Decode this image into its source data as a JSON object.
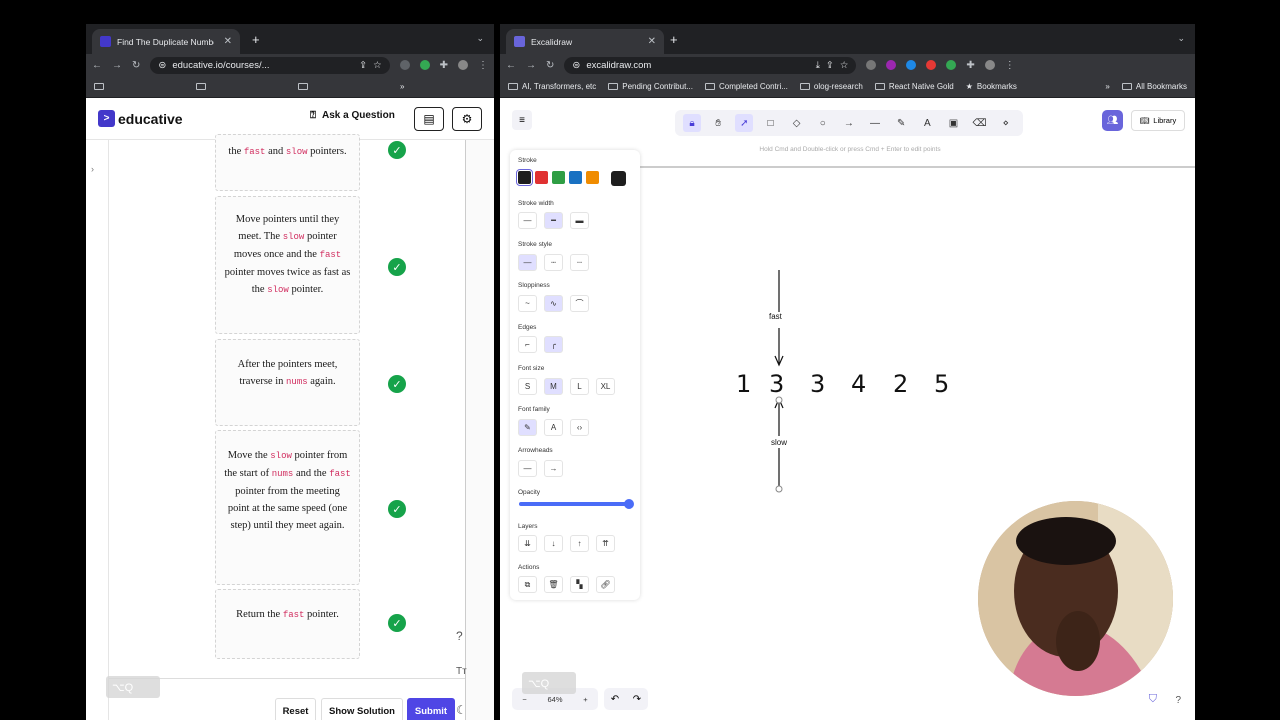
{
  "left_window": {
    "tab_title": "Find The Duplicate Number - C",
    "url": "educative.io/courses/...",
    "logo_text": "educative",
    "ask_question": "Ask a Question",
    "steps": [
      {
        "parts": [
          {
            "t": "the "
          },
          {
            "c": "fast"
          },
          {
            "t": " and "
          },
          {
            "c": "slow"
          },
          {
            "t": " pointers."
          }
        ]
      },
      {
        "parts": [
          {
            "t": "Move pointers until they meet. The "
          },
          {
            "c": "slow"
          },
          {
            "t": " pointer moves once and the "
          },
          {
            "c": "fast"
          },
          {
            "t": " pointer moves twice as fast as the "
          },
          {
            "c": "slow"
          },
          {
            "t": " pointer."
          }
        ]
      },
      {
        "parts": [
          {
            "t": "After the pointers meet, traverse in "
          },
          {
            "c": "nums"
          },
          {
            "t": " again."
          }
        ]
      },
      {
        "parts": [
          {
            "t": "Move the "
          },
          {
            "c": "slow"
          },
          {
            "t": " pointer from the start of "
          },
          {
            "c": "nums"
          },
          {
            "t": " and the "
          },
          {
            "c": "fast"
          },
          {
            "t": " pointer from the meeting point at the same speed (one step) until they meet again."
          }
        ]
      },
      {
        "parts": [
          {
            "t": "Return the "
          },
          {
            "c": "fast"
          },
          {
            "t": " pointer."
          }
        ]
      }
    ],
    "buttons": {
      "reset": "Reset",
      "show_solution": "Show Solution",
      "submit": "Submit"
    },
    "kbd_hint": "⌥Q",
    "help": "?",
    "text_size": "Tт"
  },
  "right_window": {
    "tab_title": "Excalidraw",
    "url": "excalidraw.com",
    "bookmarks": [
      "AI, Transformers, etc",
      "Pending Contribut...",
      "Completed Contri...",
      "olog-research",
      "React Native Gold",
      "Bookmarks"
    ],
    "all_bookmarks": "All Bookmarks",
    "library": "Library",
    "hint": "Hold Cmd and Double-click or press Cmd + Enter to edit points",
    "panel": {
      "stroke": "Stroke",
      "stroke_width": "Stroke width",
      "stroke_style": "Stroke style",
      "sloppiness": "Sloppiness",
      "edges": "Edges",
      "font_size": "Font size",
      "font_sizes": [
        "S",
        "M",
        "L",
        "XL"
      ],
      "font_family": "Font family",
      "arrowheads": "Arrowheads",
      "opacity": "Opacity",
      "opacity_value": 1.0,
      "layers": "Layers",
      "actions": "Actions",
      "stroke_colors": [
        "#1e1e1e",
        "#e03131",
        "#2f9e44",
        "#1971c2",
        "#f08c00"
      ]
    },
    "canvas": {
      "numbers": [
        "1",
        "3",
        "3",
        "4",
        "2",
        "5"
      ],
      "label_fast": "fast",
      "label_slow": "slow"
    },
    "zoom": "64%",
    "kbd_hint": "⌥Q"
  },
  "colors": {
    "brand": "#4338ca",
    "check": "#16a34a",
    "code": "#d12d5f",
    "excal_accent": "#6965db"
  }
}
